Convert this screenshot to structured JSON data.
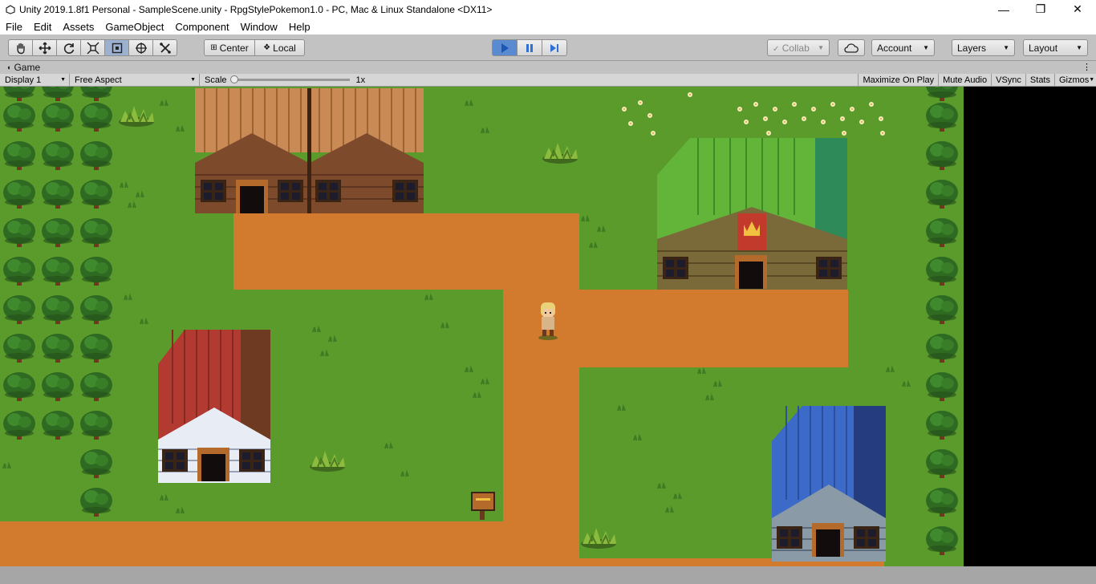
{
  "window": {
    "title": "Unity 2019.1.8f1 Personal - SampleScene.unity - RpgStylePokemon1.0 - PC, Mac & Linux Standalone <DX11>",
    "minimize": "—",
    "maximize": "❐",
    "close": "✕"
  },
  "menu": [
    "File",
    "Edit",
    "Assets",
    "GameObject",
    "Component",
    "Window",
    "Help"
  ],
  "toolbar": {
    "tools": [
      "hand-tool",
      "move-tool",
      "rotate-tool",
      "scale-tool",
      "rect-tool",
      "transform-tool",
      "custom-tool"
    ],
    "pivot_label": "Center",
    "space_label": "Local",
    "collab_label": "Collab",
    "account_label": "Account",
    "layers_label": "Layers",
    "layout_label": "Layout",
    "play_color": "#2f6fd6"
  },
  "tab": {
    "label": "Game"
  },
  "gamebar": {
    "display": "Display 1",
    "aspect": "Free Aspect",
    "scale_label": "Scale",
    "scale_value": "1x",
    "maximize": "Maximize On Play",
    "mute": "Mute Audio",
    "vsync": "VSync",
    "stats": "Stats",
    "gizmos": "Gizmos"
  },
  "colors": {
    "grass": "#5a9b2b",
    "dirt": "#d27a2d",
    "tree": "#2f6a22",
    "trunk": "#6b3a1e",
    "roof_wood": "#c98a55",
    "roof_green": "#63b53a",
    "roof_red": "#b33a30",
    "roof_blue": "#3c6ac8"
  }
}
